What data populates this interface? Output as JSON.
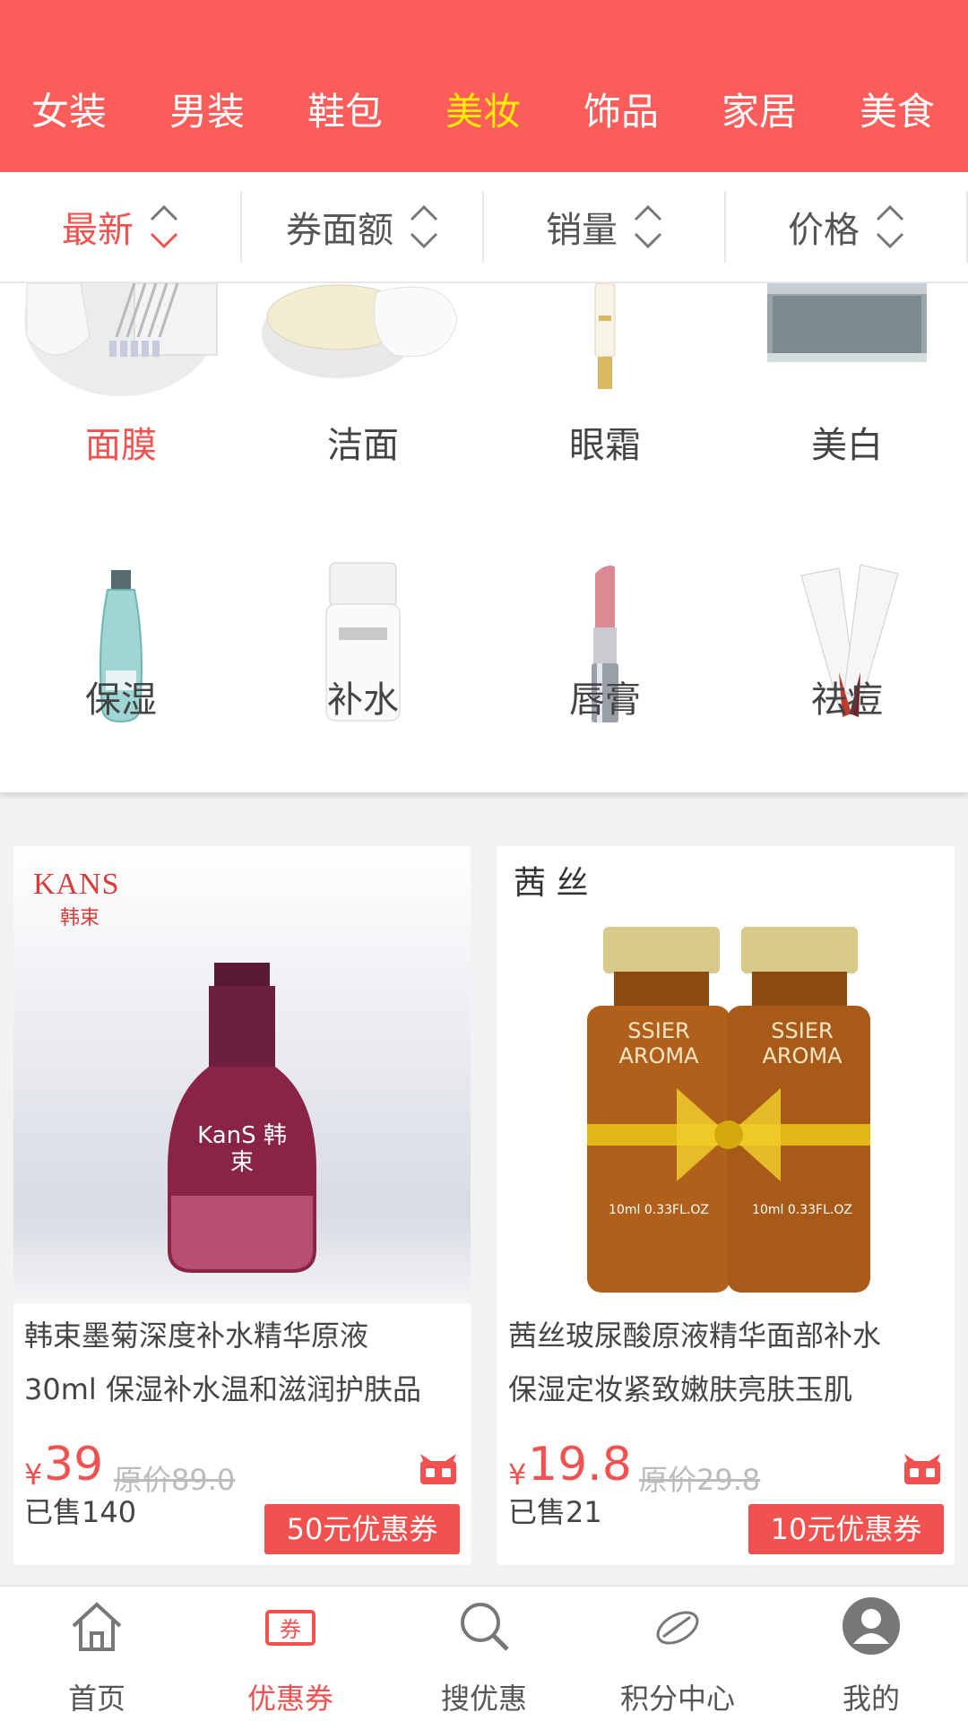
{
  "categories": [
    {
      "label": "女装",
      "active": false
    },
    {
      "label": "男装",
      "active": false
    },
    {
      "label": "鞋包",
      "active": false
    },
    {
      "label": "美妆",
      "active": true
    },
    {
      "label": "饰品",
      "active": false
    },
    {
      "label": "家居",
      "active": false
    },
    {
      "label": "美食",
      "active": false
    }
  ],
  "sort": [
    {
      "label": "最新",
      "active": true
    },
    {
      "label": "券面额",
      "active": false
    },
    {
      "label": "销量",
      "active": false
    },
    {
      "label": "价格",
      "active": false
    }
  ],
  "subcategories": [
    {
      "label": "面膜",
      "active": true
    },
    {
      "label": "洁面",
      "active": false
    },
    {
      "label": "眼霜",
      "active": false
    },
    {
      "label": "美白",
      "active": false
    },
    {
      "label": "保湿",
      "active": false
    },
    {
      "label": "补水",
      "active": false
    },
    {
      "label": "唇膏",
      "active": false
    },
    {
      "label": "祛痘",
      "active": false
    }
  ],
  "products": [
    {
      "brand": "KANS",
      "brand_cn": "韩束",
      "product_text": "KanS 韩束",
      "title_line1": "韩束墨菊深度补水精华原液",
      "title_line2": "30ml 保湿补水温和滋润护肤品",
      "currency": "¥",
      "price": "39",
      "original_price": "原价89.0",
      "sold": "已售140",
      "coupon": "50元优惠券"
    },
    {
      "brand": "茜 丝",
      "product_text": "SSIER AROMA",
      "bottle_label": "10ml 0.33FL.OZ",
      "title_line1": "茜丝玻尿酸原液精华面部补水",
      "title_line2": "保湿定妆紧致嫩肤亮肤玉肌",
      "currency": "¥",
      "price": "19.8",
      "original_price": "原价29.8",
      "sold": "已售21",
      "coupon": "10元优惠券"
    }
  ],
  "tabs": [
    {
      "label": "首页",
      "icon": "home-icon",
      "active": false
    },
    {
      "label": "优惠券",
      "icon": "coupon-icon",
      "active": true
    },
    {
      "label": "搜优惠",
      "icon": "search-icon",
      "active": false
    },
    {
      "label": "积分中心",
      "icon": "points-icon",
      "active": false
    },
    {
      "label": "我的",
      "icon": "profile-icon",
      "active": false
    }
  ],
  "colors": {
    "primary": "#fb5d5a",
    "accent_text": "#f2524f",
    "active_category": "#ffee00"
  }
}
